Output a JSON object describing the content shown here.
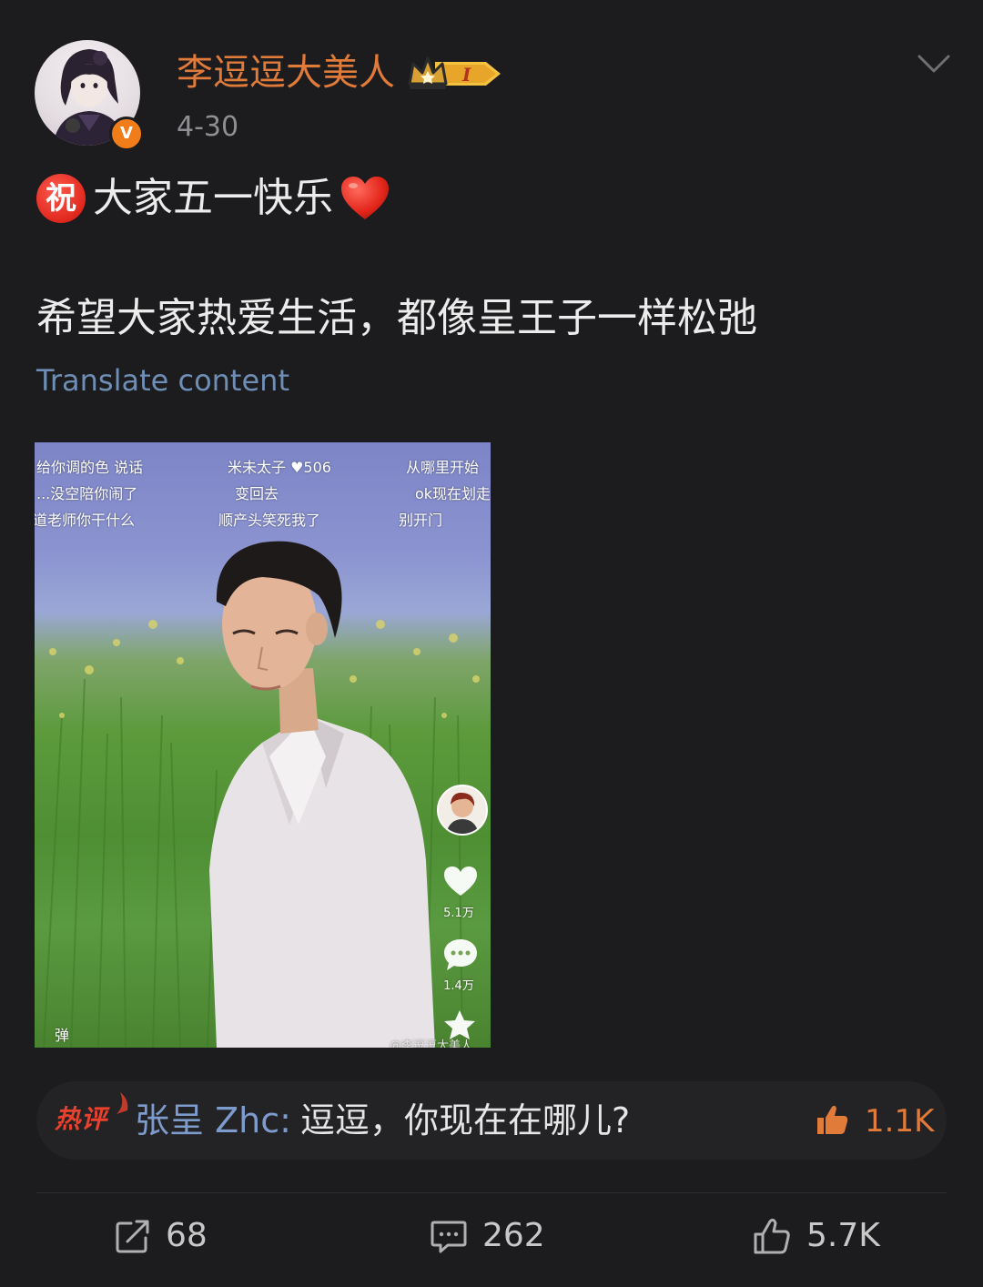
{
  "post": {
    "author": {
      "name": "李逗逗大美人",
      "verified_badge": "V",
      "level_badge": "I",
      "name_color": "#e07b3a"
    },
    "date": "4-30",
    "content": {
      "line1_emoji": "祝",
      "line1_text": "大家五一快乐",
      "line1_trailing_icon": "red-heart-icon",
      "line2": "希望大家热爱生活，都像呈王子一样松弛",
      "translate_label": "Translate content"
    },
    "media": {
      "danmaku": [
        "给你调的色 说话",
        "...没空陪你闹了",
        "道老师你干什么",
        "米未太子 ♥506",
        "变回去",
        "顺产头笑死我了",
        "从哪里开始",
        "ok现在划走",
        "别开门"
      ],
      "like_count": "5.1万",
      "comment_count": "1.4万",
      "danmu_label": "弹",
      "watermark": "@李逗逗大美人"
    },
    "hot_comment": {
      "badge": "热评",
      "author": "张呈 Zhc:",
      "text": "逗逗，你现在在哪儿?",
      "like_count": "1.1K"
    },
    "actions": {
      "repost_count": "68",
      "comment_count": "262",
      "like_count": "5.7K"
    }
  }
}
